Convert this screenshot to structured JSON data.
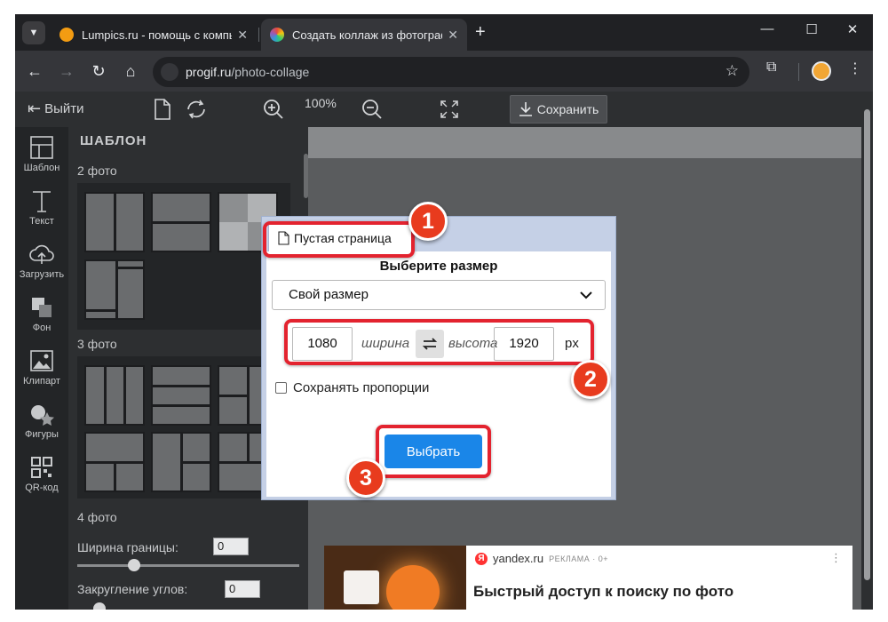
{
  "browser": {
    "tabs": [
      {
        "title": "Lumpics.ru - помощь с компью",
        "active": false
      },
      {
        "title": "Создать коллаж из фотограф",
        "active": true
      }
    ],
    "url_domain": "progif.ru",
    "url_path": "/photo-collage"
  },
  "app": {
    "exit_label": "Выйти",
    "zoom": "100%",
    "save_label": "Сохранить",
    "sidebar": [
      {
        "label": "Шаблон",
        "icon": "template-icon"
      },
      {
        "label": "Текст",
        "icon": "text-icon"
      },
      {
        "label": "Загрузить",
        "icon": "upload-cloud-icon"
      },
      {
        "label": "Фон",
        "icon": "background-icon"
      },
      {
        "label": "Клипарт",
        "icon": "clipart-icon"
      },
      {
        "label": "Фигуры",
        "icon": "shapes-icon"
      },
      {
        "label": "QR-код",
        "icon": "qr-code-icon"
      }
    ],
    "panel": {
      "title": "ШАБЛОН",
      "sections": [
        "2 фото",
        "3 фото",
        "4 фото"
      ],
      "border_width_label": "Ширина границы:",
      "border_width_value": "0",
      "corner_round_label": "Закругление углов:",
      "corner_round_value": "0"
    }
  },
  "dialog": {
    "tab_label": "Пустая страница",
    "heading": "Выберите размер",
    "size_option": "Свой размер",
    "width": "1080",
    "width_label": "ширина",
    "height_label": "высота",
    "height": "1920",
    "unit": "px",
    "keep_ratio_label": "Сохранять пропорции",
    "choose_label": "Выбрать"
  },
  "ad": {
    "source": "yandex.ru",
    "tag": "РЕКЛАМА · 0+",
    "headline": "Быстрый доступ к поиску по фото"
  },
  "annotations": [
    "1",
    "2",
    "3"
  ],
  "colors": {
    "highlight": "#e3232f",
    "badge": "#e83b1e",
    "primary_button": "#1a86e8"
  }
}
